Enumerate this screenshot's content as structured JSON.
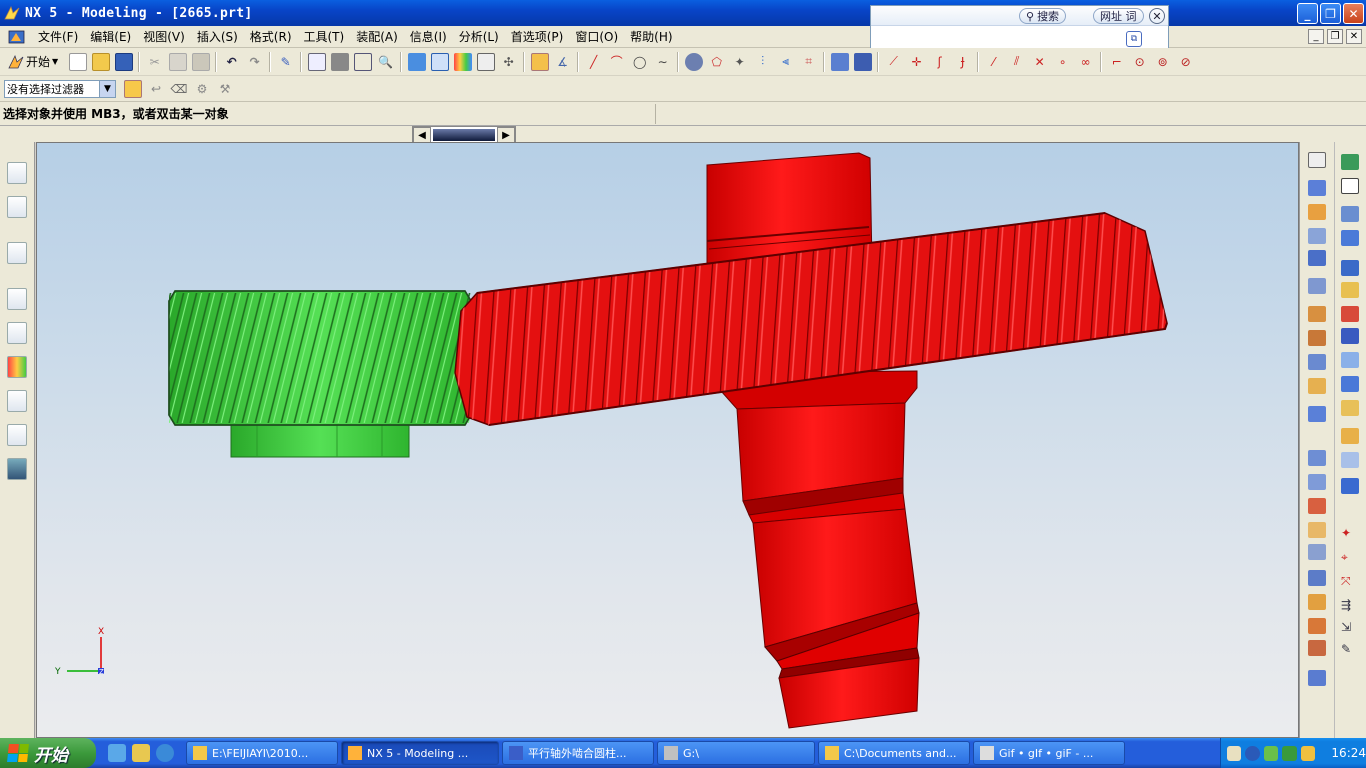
{
  "window": {
    "title": "NX 5 - Modeling - [2665.prt]",
    "buttons": [
      "_",
      "❐",
      "✕"
    ]
  },
  "search_widget": {
    "search_label": "搜索",
    "url_label": "网址 词",
    "close": "✕"
  },
  "menu": {
    "items": [
      "文件(F)",
      "编辑(E)",
      "视图(V)",
      "插入(S)",
      "格式(R)",
      "工具(T)",
      "装配(A)",
      "信息(I)",
      "分析(L)",
      "首选项(P)",
      "窗口(O)",
      "帮助(H)"
    ]
  },
  "toolbar": {
    "start_label": "开始",
    "filter_value": "没有选择过滤器"
  },
  "cueline": {
    "text": "选择对象并使用 MB3，或者双击某一对象"
  },
  "viewport": {
    "triad": {
      "x_label": "X",
      "y_label": "Y",
      "z_label": "Z"
    },
    "colors": {
      "pinion": "#3fcf3f",
      "gear": "#ee0e0e"
    }
  },
  "taskbar": {
    "start_label": "开始",
    "tasks": [
      {
        "label": "E:\\FEIJIAYI\\2010...",
        "icon": "folder-icon"
      },
      {
        "label": "NX 5 - Modeling ...",
        "icon": "nx-icon",
        "active": true
      },
      {
        "label": "平行轴外啮合圆柱...",
        "icon": "word-icon"
      },
      {
        "label": "G:\\",
        "icon": "drive-icon"
      },
      {
        "label": "C:\\Documents and...",
        "icon": "folder-icon"
      },
      {
        "label": "Gif • gIf • giF - ...",
        "icon": "gif-icon"
      }
    ],
    "clock": "16:24"
  }
}
